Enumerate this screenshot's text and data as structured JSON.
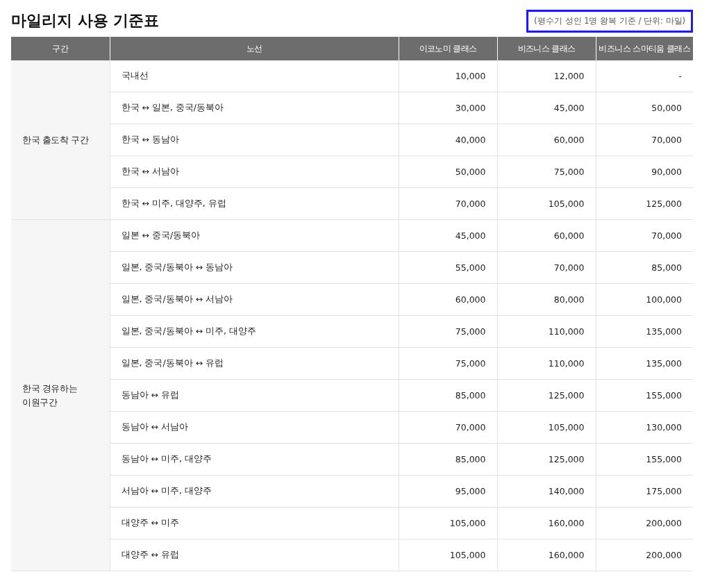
{
  "title": "마일리지 사용 기준표",
  "note": "(평수기 성인 1명 왕복 기준 / 단위: 마일)",
  "table": {
    "columns": [
      "구간",
      "노선",
      "이코노미 클래스",
      "비즈니스 클래스",
      "비즈니스 스마티움 클래스"
    ],
    "groups": [
      {
        "name": "한국 출도착 구간",
        "rows": [
          [
            "국내선",
            "10,000",
            "12,000",
            "-"
          ],
          [
            "한국 ↔ 일본, 중국/동북아",
            "30,000",
            "45,000",
            "50,000"
          ],
          [
            "한국 ↔ 동남아",
            "40,000",
            "60,000",
            "70,000"
          ],
          [
            "한국 ↔ 서남아",
            "50,000",
            "75,000",
            "90,000"
          ],
          [
            "한국 ↔ 미주, 대양주, 유럽",
            "70,000",
            "105,000",
            "125,000"
          ]
        ]
      },
      {
        "name": "한국 경유하는 이원구간",
        "rows": [
          [
            "일본 ↔ 중국/동북아",
            "45,000",
            "60,000",
            "70,000"
          ],
          [
            "일본, 중국/동북아 ↔ 동남아",
            "55,000",
            "70,000",
            "85,000"
          ],
          [
            "일본, 중국/동북아 ↔ 서남아",
            "60,000",
            "80,000",
            "100,000"
          ],
          [
            "일본, 중국/동북아 ↔ 미주, 대양주",
            "75,000",
            "110,000",
            "135,000"
          ],
          [
            "일본, 중국/동북아 ↔ 유럽",
            "75,000",
            "110,000",
            "135,000"
          ],
          [
            "동남아 ↔ 유럽",
            "85,000",
            "125,000",
            "155,000"
          ],
          [
            "동남아 ↔ 서남아",
            "70,000",
            "105,000",
            "130,000"
          ],
          [
            "동남아 ↔ 미주, 대양주",
            "85,000",
            "125,000",
            "155,000"
          ],
          [
            "서남아 ↔ 미주, 대양주",
            "95,000",
            "140,000",
            "175,000"
          ],
          [
            "대양주 ↔ 미주",
            "105,000",
            "160,000",
            "200,000"
          ],
          [
            "대양주 ↔ 유럽",
            "105,000",
            "160,000",
            "200,000"
          ]
        ]
      }
    ]
  }
}
